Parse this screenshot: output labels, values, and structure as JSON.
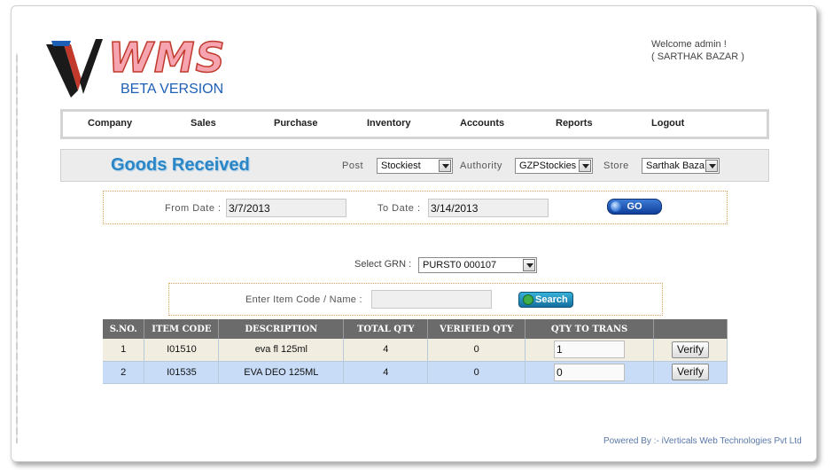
{
  "app": {
    "logo_text": "WMS",
    "logo_subtitle": "BETA VERSION"
  },
  "welcome": {
    "line1": "Welcome admin !",
    "line2": "( SARTHAK BAZAR )"
  },
  "nav": {
    "items": [
      "Company",
      "Sales",
      "Purchase",
      "Inventory",
      "Accounts",
      "Reports",
      "Logout"
    ]
  },
  "header": {
    "title": "Goods Received",
    "post_label": "Post",
    "post_value": "Stockiest",
    "authority_label": "Authority",
    "authority_value": "GZPStockies",
    "store_label": "Store",
    "store_value": "Sarthak Baza"
  },
  "dates": {
    "from_label": "From Date :",
    "from_value": "3/7/2013",
    "to_label": "To Date :",
    "to_value": "3/14/2013",
    "go_label": "GO"
  },
  "grn": {
    "label": "Select GRN :",
    "value": "PURST0  000107"
  },
  "search": {
    "label": "Enter Item Code / Name :",
    "value": "",
    "button_label": "Search"
  },
  "table": {
    "columns": [
      "S.NO.",
      "ITEM CODE",
      "DESCRIPTION",
      "TOTAL QTY",
      "VERIFIED QTY",
      "QTY TO TRANS",
      ""
    ],
    "rows": [
      {
        "sno": "1",
        "item_code": "I01510",
        "description": "eva fl 125ml",
        "total_qty": "4",
        "verified_qty": "0",
        "qty_to_trans": "1",
        "action": "Verify"
      },
      {
        "sno": "2",
        "item_code": "I01535",
        "description": "EVA DEO 125ML",
        "total_qty": "4",
        "verified_qty": "0",
        "qty_to_trans": "0",
        "action": "Verify"
      }
    ]
  },
  "footer": {
    "text": "Powered By :- iVerticals Web Technologies Pvt Ltd"
  },
  "colors": {
    "title": "#2a86c6",
    "table_header": "#6b6b6b",
    "row_alt": "#c8dcf7",
    "row_base": "#f1ede1"
  }
}
